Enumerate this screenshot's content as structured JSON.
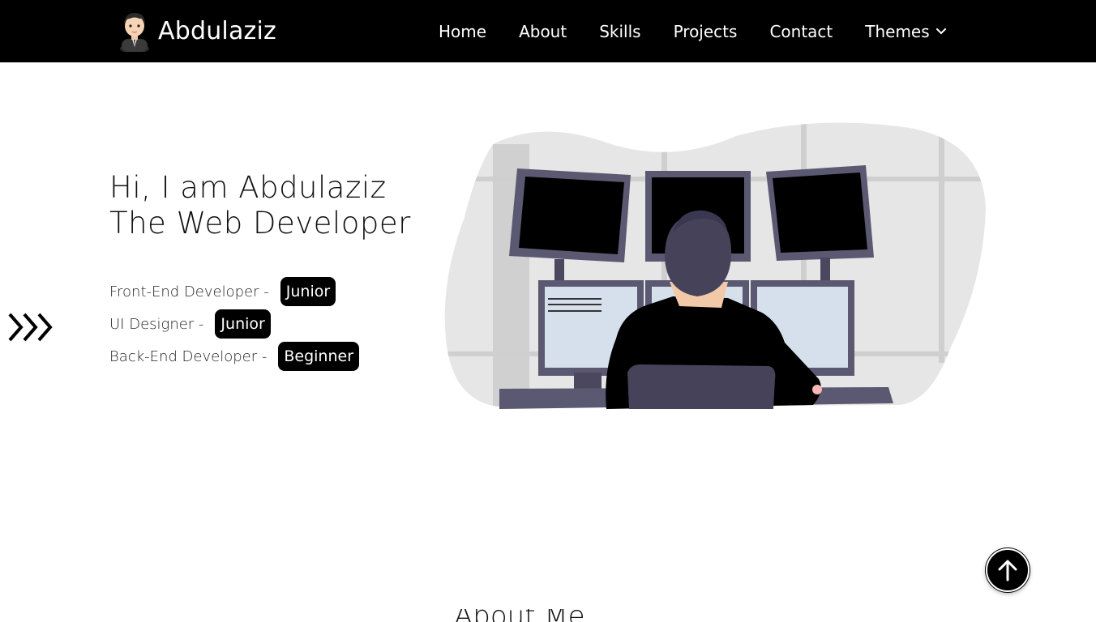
{
  "navbar": {
    "brand_name": "Abdulaziz",
    "links": [
      {
        "label": "Home"
      },
      {
        "label": "About"
      },
      {
        "label": "Skills"
      },
      {
        "label": "Projects"
      },
      {
        "label": "Contact"
      },
      {
        "label": "Themes"
      }
    ]
  },
  "hero": {
    "title": "Hi, I am Abdulaziz The Web Developer",
    "roles": [
      {
        "label": "Front-End Developer -",
        "level": "Junior"
      },
      {
        "label": "UI Designer -",
        "level": "Junior"
      },
      {
        "label": "Back-End Developer -",
        "level": "Beginner"
      }
    ]
  },
  "next_section": {
    "heading_partial": "About Me"
  },
  "icons": {
    "avatar": "avatar",
    "themes_dropdown": "chevron-down-icon",
    "scroll_indicator": "triple-chevron-right-icon",
    "scroll_top": "arrow-up-icon"
  },
  "colors": {
    "navbar_bg": "#000000",
    "badge_bg": "#000000",
    "monitor_frame": "#5b5872",
    "screen_light": "#d6e0ec",
    "blob_bg": "#e6e6e6"
  }
}
